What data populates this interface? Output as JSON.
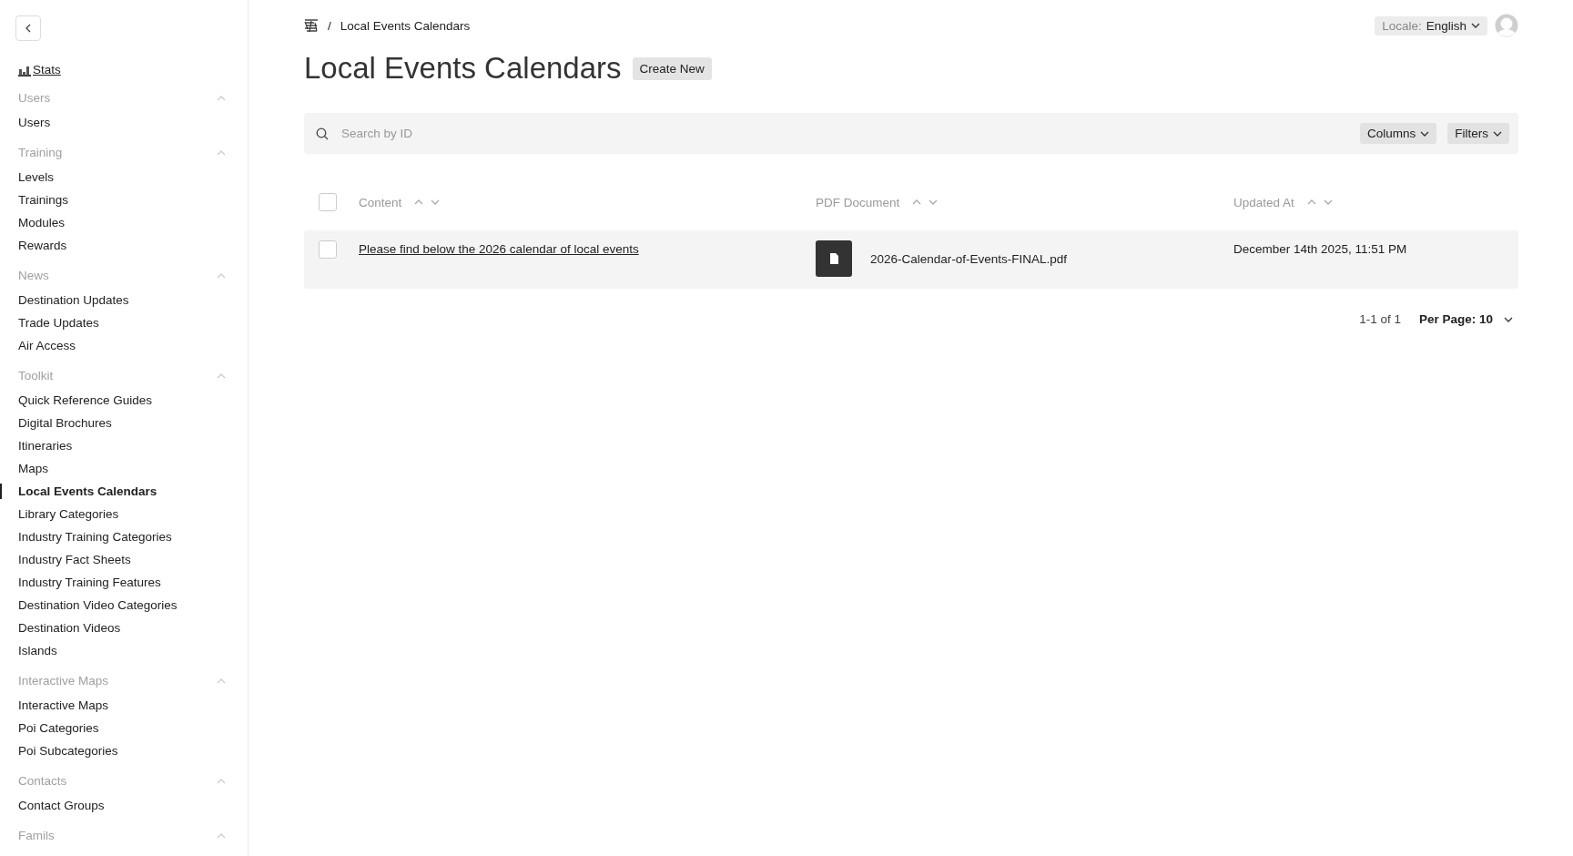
{
  "sidebar": {
    "stats_link": "Stats",
    "groups": [
      {
        "title": "Users",
        "expanded": true,
        "items": [
          {
            "label": "Users",
            "selected": false
          }
        ]
      },
      {
        "title": "Training",
        "expanded": true,
        "items": [
          {
            "label": "Levels",
            "selected": false
          },
          {
            "label": "Trainings",
            "selected": false
          },
          {
            "label": "Modules",
            "selected": false
          },
          {
            "label": "Rewards",
            "selected": false
          }
        ]
      },
      {
        "title": "News",
        "expanded": true,
        "items": [
          {
            "label": "Destination Updates",
            "selected": false
          },
          {
            "label": "Trade Updates",
            "selected": false
          },
          {
            "label": "Air Access",
            "selected": false
          }
        ]
      },
      {
        "title": "Toolkit",
        "expanded": true,
        "items": [
          {
            "label": "Quick Reference Guides",
            "selected": false
          },
          {
            "label": "Digital Brochures",
            "selected": false
          },
          {
            "label": "Itineraries",
            "selected": false
          },
          {
            "label": "Maps",
            "selected": false
          },
          {
            "label": "Local Events Calendars",
            "selected": true
          },
          {
            "label": "Library Categories",
            "selected": false
          },
          {
            "label": "Industry Training Categories",
            "selected": false
          },
          {
            "label": "Industry Fact Sheets",
            "selected": false
          },
          {
            "label": "Industry Training Features",
            "selected": false
          },
          {
            "label": "Destination Video Categories",
            "selected": false
          },
          {
            "label": "Destination Videos",
            "selected": false
          },
          {
            "label": "Islands",
            "selected": false
          }
        ]
      },
      {
        "title": "Interactive Maps",
        "expanded": true,
        "items": [
          {
            "label": "Interactive Maps",
            "selected": false
          },
          {
            "label": "Poi Categories",
            "selected": false
          },
          {
            "label": "Poi Subcategories",
            "selected": false
          }
        ]
      },
      {
        "title": "Contacts",
        "expanded": true,
        "items": [
          {
            "label": "Contact Groups",
            "selected": false
          }
        ]
      },
      {
        "title": "Famils",
        "expanded": true
      }
    ]
  },
  "breadcrumb": {
    "separator": "/",
    "current": "Local Events Calendars"
  },
  "locale": {
    "label": "Locale:",
    "value": "English"
  },
  "page_title": "Local Events Calendars",
  "create_button": "Create New",
  "search": {
    "placeholder": "Search by ID"
  },
  "toolbar_buttons": [
    "Columns",
    "Filters"
  ],
  "table": {
    "select_all": {
      "checked": false
    },
    "columns": [
      {
        "label": "Content"
      },
      {
        "label": "PDF Document"
      },
      {
        "label": "Updated At"
      }
    ],
    "rows": [
      {
        "selected": false,
        "content": "Please find below the 2026 calendar of local events",
        "pdf_document": "2026-Calendar-of-Events-FINAL.pdf",
        "updated_at": "December 14th 2025, 11:51 PM"
      }
    ]
  },
  "pagination": {
    "range": "1-1 of 1",
    "per_page": "Per Page: 10"
  }
}
